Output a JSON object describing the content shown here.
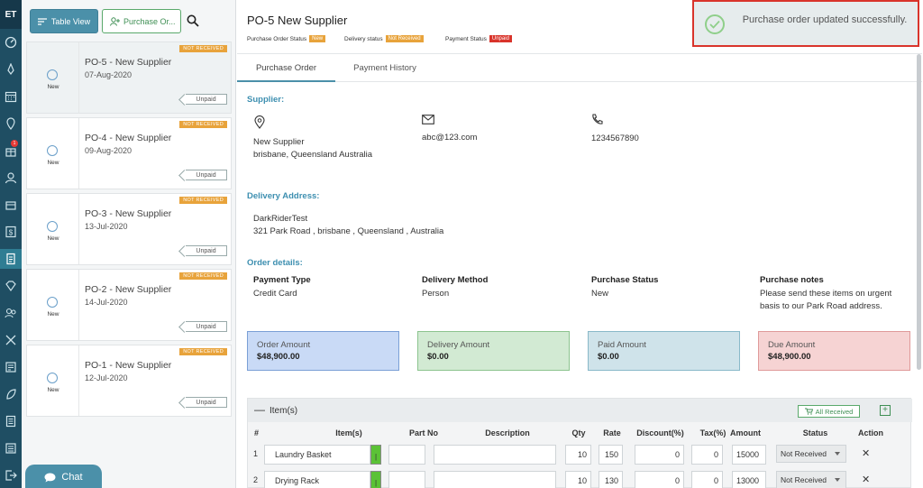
{
  "rail": {
    "logo": "ET",
    "notification_count": "1"
  },
  "toolbar": {
    "table_view_label": "Table View",
    "purchase_order_label": "Purchase Or..."
  },
  "orders": [
    {
      "title": "PO-5 - New Supplier",
      "date": "07-Aug-2020",
      "status": "New",
      "receive_status": "NOT RECEIVED",
      "payment": "Unpaid"
    },
    {
      "title": "PO-4 - New Supplier",
      "date": "09-Aug-2020",
      "status": "New",
      "receive_status": "NOT RECEIVED",
      "payment": "Unpaid"
    },
    {
      "title": "PO-3 - New Supplier",
      "date": "13-Jul-2020",
      "status": "New",
      "receive_status": "NOT RECEIVED",
      "payment": "Unpaid"
    },
    {
      "title": "PO-2 - New Supplier",
      "date": "14-Jul-2020",
      "status": "New",
      "receive_status": "NOT RECEIVED",
      "payment": "Unpaid"
    },
    {
      "title": "PO-1 - New Supplier",
      "date": "12-Jul-2020",
      "status": "New",
      "receive_status": "NOT RECEIVED",
      "payment": "Unpaid"
    }
  ],
  "chat": {
    "label": "Chat"
  },
  "header": {
    "title": "PO-5 New Supplier",
    "po_status_label": "Purchase Order Status",
    "po_status": "New",
    "delivery_status_label": "Delivery status",
    "delivery_status": "Not Received",
    "payment_status_label": "Payment Status",
    "payment_status": "Unpaid"
  },
  "toast": {
    "message": "Purchase order updated successfully."
  },
  "tabs": {
    "purchase_order": "Purchase Order",
    "payment_history": "Payment History"
  },
  "supplier": {
    "heading": "Supplier:",
    "name": "New Supplier",
    "location": "brisbane, Queensland Australia",
    "email": "abc@123.com",
    "phone": "1234567890"
  },
  "delivery": {
    "heading": "Delivery Address:",
    "name": "DarkRiderTest",
    "address": "321 Park Road , brisbane , Queensland , Australia"
  },
  "details": {
    "heading": "Order details:",
    "payment_type_label": "Payment Type",
    "payment_type": "Credit Card",
    "delivery_method_label": "Delivery Method",
    "delivery_method": "Person",
    "purchase_status_label": "Purchase Status",
    "purchase_status": "New",
    "notes_label": "Purchase notes",
    "notes_line1": "Please send these items on urgent",
    "notes_line2": "basis to our Park Road address."
  },
  "amounts": {
    "order_label": "Order Amount",
    "order": "$48,900.00",
    "delivery_label": "Delivery Amount",
    "delivery": "$0.00",
    "paid_label": "Paid Amount",
    "paid": "$0.00",
    "due_label": "Due Amount",
    "due": "$48,900.00"
  },
  "items": {
    "heading": "Item(s)",
    "all_received_label": "All Received",
    "columns": [
      "#",
      "Item(s)",
      "Part No",
      "Description",
      "Qty",
      "Rate",
      "Discount(%)",
      "Tax(%)",
      "Amount",
      "Status",
      "Action"
    ],
    "rows": [
      {
        "no": "1",
        "item": "Laundry Basket",
        "part": "",
        "desc": "",
        "qty": "10",
        "rate": "150",
        "discount": "0",
        "tax": "0",
        "amount": "15000",
        "status": "Not Received"
      },
      {
        "no": "2",
        "item": "Drying Rack",
        "part": "",
        "desc": "",
        "qty": "10",
        "rate": "130",
        "discount": "0",
        "tax": "0",
        "amount": "13000",
        "status": "Not Received"
      }
    ]
  },
  "colors": {
    "accent": "#4b90a9",
    "order_bg": "#c9daf6",
    "delivery_bg": "#d2ead3",
    "paid_bg": "#cfe3ea",
    "due_bg": "#f6d3d3",
    "not_received": "#e8a33b",
    "unpaid": "#d9342b"
  }
}
